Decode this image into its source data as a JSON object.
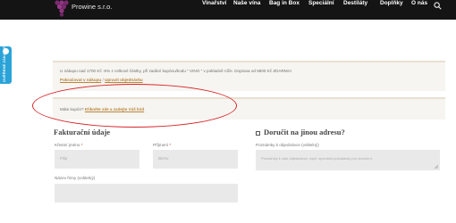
{
  "header": {
    "brand": "Prowine s.r.o.",
    "nav": [
      "Vinařství",
      "Naše vína",
      "Bag in Box",
      "Speciální",
      "Destiláty",
      "Doplňky",
      "O nás"
    ]
  },
  "side_tab": {
    "label": "OVĚŘENÉ ZÁKAZNÍKY"
  },
  "notice1": {
    "text": "U nákupu nad 1700 Kč -5% z celkové částky, při zadání kupónu/kodu \" VINO \" v pokladně níže. Doprava od 5800 Kč ZDARMA!",
    "link1": "Pokračovat v nákupu",
    "separator": "/",
    "link2": "Upravit objednávku"
  },
  "notice2": {
    "text": "Máte kupón?",
    "link": "Klikněte zde a zadejte Váš kód"
  },
  "billing": {
    "title": "Fakturační údaje",
    "first_name_label": "Křestní jméno",
    "first_name_value": "Filip",
    "last_name_label": "Příjmení",
    "last_name_value": "Berev",
    "company_label": "Název firmy (volitelný)",
    "required_mark": "*"
  },
  "shipping": {
    "title": "Doručit na jinou adresu?",
    "notes_label": "Poznámky k objednávce (volitelný)",
    "notes_placeholder": "Poznámky k vaší objednávce, např. speciální požadavky pro doručení."
  },
  "colors": {
    "header_bg": "#141414",
    "accent_link": "#b8863e",
    "side_tab": "#2aa3d8",
    "annotation": "#d8262a"
  },
  "icons": {
    "logo": "grape-logo-icon",
    "search": "search-icon",
    "side": "verified-icon"
  }
}
